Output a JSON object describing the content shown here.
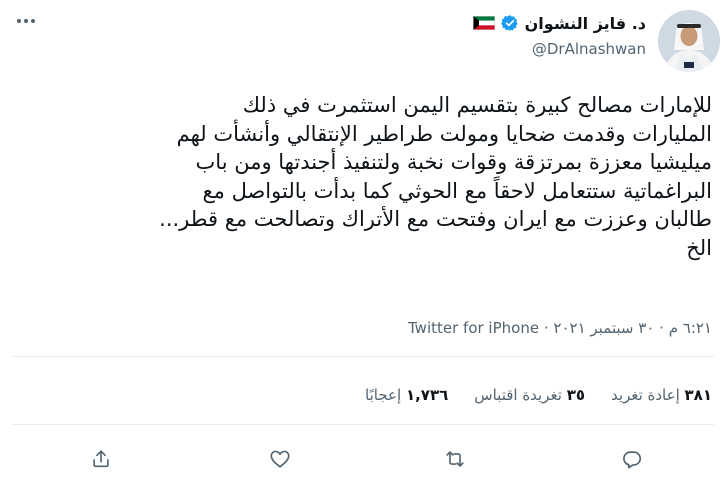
{
  "author": {
    "name": "د. فايز النشوان",
    "handle": "@DrAlnashwan"
  },
  "tweet": {
    "text": "للإمارات مصالح كبيرة بتقسيم اليمن استثمرت في ذلك\nالمليارات وقدمت ضحايا ومولت طراطير الإنتقالي وأنشأت لهم\nميليشيا معززة بمرتزقة وقوات نخبة ولتنفيذ أجندتها ومن باب\nالبراغماتية ستتعامل لاحقاً مع الحوثي كما بدأت بالتواصل مع\nطالبان وعززت مع ايران وفتحت مع الأتراك وتصالحت مع قطر...\nالخ",
    "timestamp": "٦:٢١ م · ٣٠ سبتمبر ٢٠٢١",
    "source": "Twitter for iPhone"
  },
  "stats": {
    "retweets_count": "٣٨١",
    "retweets_label": "إعادة تغريد",
    "quotes_count": "٣٥",
    "quotes_label": "تغريدة اقتباس",
    "likes_count": "١,٧٣٦",
    "likes_label": "إعجابًا"
  },
  "icons": {
    "more": "more-dots-icon",
    "verified": "verified-badge-icon",
    "flag": "kuwait-flag-icon",
    "reply": "reply-icon",
    "retweet": "retweet-icon",
    "like": "heart-icon",
    "share": "share-icon"
  },
  "colors": {
    "verified": "#1d9bf0",
    "text": "#0f1419",
    "muted": "#536471",
    "divider": "#e6ecf0"
  }
}
